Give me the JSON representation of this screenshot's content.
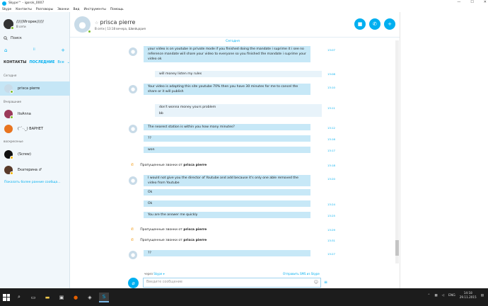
{
  "window": {
    "title": "Skype™ - igorok_0007",
    "min": "—",
    "max": "☐",
    "close": "✕"
  },
  "menu": [
    "Skype",
    "Контакты",
    "Разговоры",
    "Звонки",
    "Вид",
    "Инструменты",
    "Помощь"
  ],
  "profile": {
    "name": "//////Игорек//////",
    "status": "В сети"
  },
  "search": {
    "label": "Поиск"
  },
  "tabs": {
    "contacts": "КОНТАКТЫ",
    "recent": "ПОСЛЕДНИЕ",
    "all": "Все"
  },
  "sections": {
    "today": "Сегодня",
    "yesterday": "Вчерашние",
    "week": "воскресенье"
  },
  "contacts": [
    {
      "name": "prisca pierre"
    },
    {
      "name": "ItsAnna"
    },
    {
      "name": "(¯`·._) ВАРНЕТ"
    },
    {
      "name": "(Screw)"
    },
    {
      "name": "Екатерина ♂"
    }
  ],
  "more_link": "Показать более ранние сообща...",
  "chat_header": {
    "name": "prisca pierre",
    "status": "В сети | 13:18 вечера, Швейцария"
  },
  "day_label": "Сегодня",
  "messages": [
    {
      "text": "your video is on youtube in private mode if you finished doing the mandate i suprime it i see no reference mandate will share your video to everyone so you finished the mandate i suprime your video ok",
      "time": "13:07"
    },
    {
      "text": "will money listen my rules",
      "time": "13:08"
    },
    {
      "text": "Your video is adapting this site youtube 70% then you have 30 minutes for me to cancel the share or it will publish",
      "time": "13:10"
    },
    {
      "text": "don't wonna money yours problem",
      "time": "13:11"
    },
    {
      "text": "bb",
      "time": ""
    },
    {
      "text": "The nearest station is within you how many minutes?",
      "time": "13:12"
    },
    {
      "text": "??",
      "time": "13:16"
    },
    {
      "text": "won",
      "time": "13:17"
    },
    {
      "text": "I would not give you the director of Youtube and add because it's only one able removed the video from Youtube",
      "time": "13:20"
    },
    {
      "text": "Ok",
      "time": ""
    },
    {
      "text": "Ok",
      "time": "13:24"
    },
    {
      "text": "You are the answer me quickly",
      "time": "13:25"
    },
    {
      "text": "??",
      "time": "13:27"
    }
  ],
  "missed": [
    {
      "label": "Пропущенные звонки от",
      "name": "prisca pierre",
      "time": "13:18"
    },
    {
      "label": "Пропущенные звонки от",
      "name": "prisca pierre",
      "time": "13:29"
    },
    {
      "label": "Пропущенные звонки от",
      "name": "prisca pierre",
      "time": "13:31"
    }
  ],
  "compose": {
    "via": "через",
    "via_link": "Skype ▾",
    "sms": "Отправить SMS из Skype",
    "placeholder": "Введите сообщение"
  },
  "taskbar": {
    "lang": "ENG",
    "time": "14:18",
    "date": "29.11.2015"
  }
}
